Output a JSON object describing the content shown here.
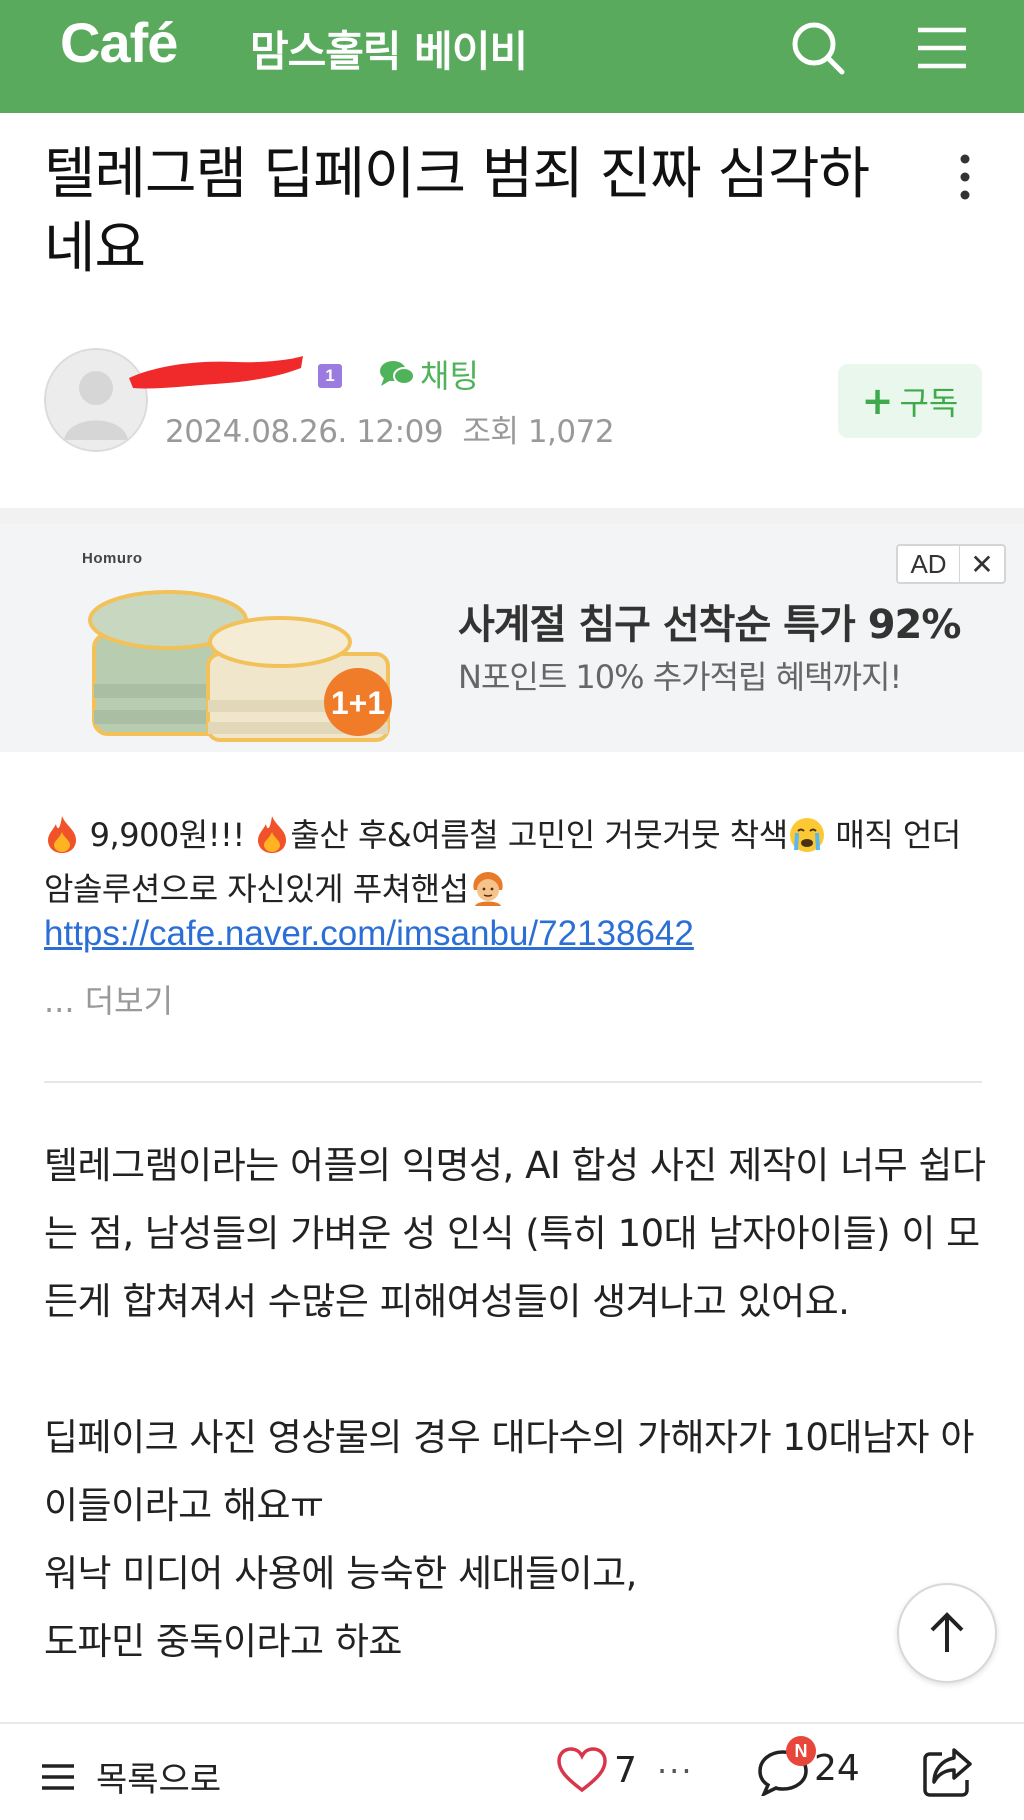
{
  "header": {
    "logo": "Café",
    "cafe_name": "맘스홀릭 베이비",
    "icons": [
      "search-icon",
      "menu-icon"
    ]
  },
  "post": {
    "title": "텔레그램 딥페이크 범죄 진짜 심각하네요",
    "author": {
      "name": "",
      "level": "1",
      "chat_label": "채팅"
    },
    "date": "2024.08.26. 12:09",
    "views_label": "조회",
    "views": "1,072",
    "subscribe_label": "구독"
  },
  "ad": {
    "brand": "Homuro",
    "badge_label": "AD",
    "headline": "사계절 침구 선착순 특가 92%",
    "sub": "N포인트 10% 추가적립 혜택까지!",
    "promo": "1+1"
  },
  "notice": {
    "part1": "9,900원!!!",
    "part2": "출산 후&여름철 고민인 거뭇거뭇 착색",
    "part3": "매직 언더암솔루션으로 자신있게 푸쳐핸섭",
    "link": "https://cafe.naver.com/imsanbu/72138642",
    "more": "... 더보기"
  },
  "body": {
    "p1": "텔레그램이라는 어플의 익명성, AI 합성 사진 제작이 너무 쉽다는 점, 남성들의 가벼운 성 인식 (특히 10대 남자아이들) 이 모든게 합쳐져서 수많은 피해여성들이 생겨나고 있어요.",
    "p2a": "딥페이크 사진 영상물의 경우 대다수의 가해자가 10대남자 아이들이라고 해요ㅠ",
    "p2b": "워낙 미디어 사용에 능숙한 세대들이고,",
    "p2c": "도파민 중독이라고 하죠"
  },
  "bottom_bar": {
    "list_label": "목록으로",
    "likes": "7",
    "more": "···",
    "comments": "24",
    "comment_badge": "N"
  },
  "colors": {
    "brand_green": "#5aaa5e",
    "link_blue": "#2b6fd6",
    "badge_red": "#e8463b",
    "level_purple": "#9b7be0"
  }
}
